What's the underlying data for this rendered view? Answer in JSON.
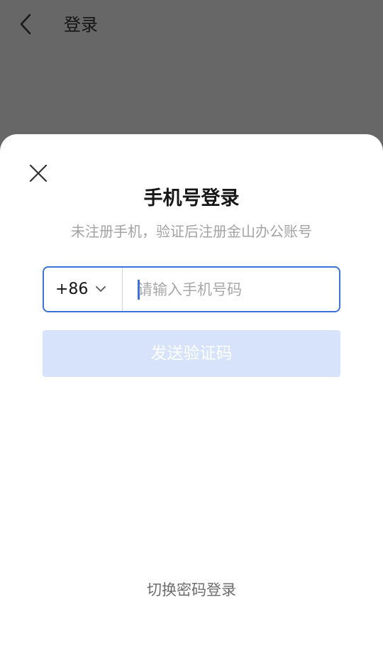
{
  "topbar": {
    "back_icon": "chevron-left-icon",
    "title": "登录"
  },
  "sheet": {
    "close_icon": "close-icon",
    "title": "手机号登录",
    "subtitle": "未注册手机，验证后注册金山办公账号",
    "phone": {
      "country_code": "+86",
      "country_code_icon": "chevron-down-icon",
      "placeholder": "请输入手机号码",
      "value": ""
    },
    "send_button_label": "发送验证码",
    "switch_link_label": "切换密码登录"
  },
  "colors": {
    "overlay": "#676767",
    "accent": "#3d72d8",
    "button_disabled": "#d6e3fb"
  }
}
